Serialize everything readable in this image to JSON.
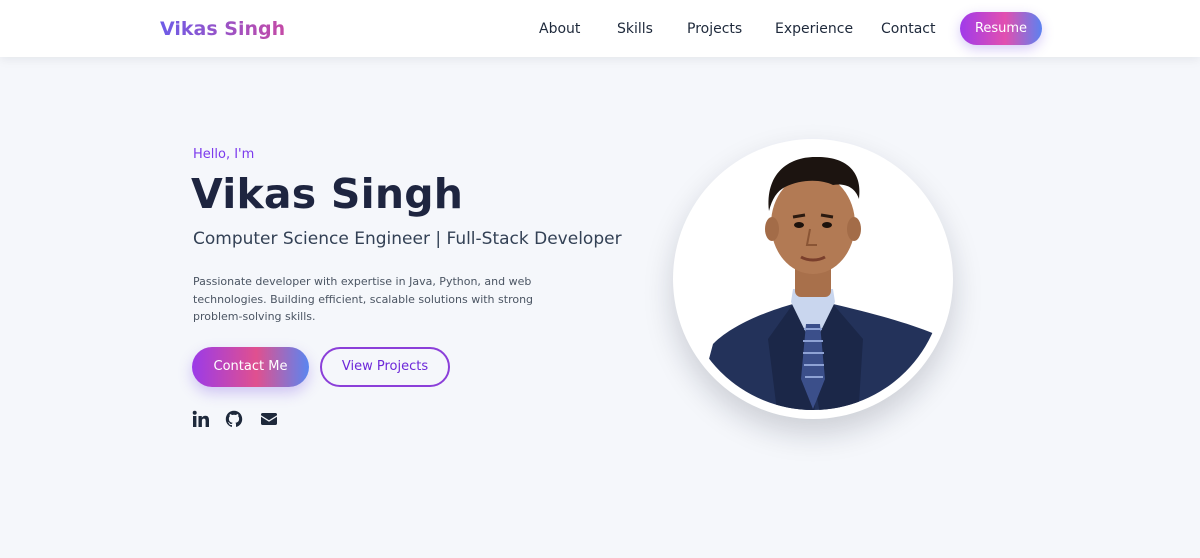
{
  "nav": {
    "logo": "Vikas Singh",
    "links": [
      "About",
      "Skills",
      "Projects",
      "Experience",
      "Contact"
    ],
    "resume_label": "Resume"
  },
  "hero": {
    "greeting": "Hello, I'm",
    "name": "Vikas Singh",
    "subtitle": "Computer Science Engineer | Full-Stack Developer",
    "description": "Passionate developer with expertise in Java, Python, and web technologies. Building efficient, scalable solutions with strong problem-solving skills.",
    "contact_button": "Contact Me",
    "projects_button": "View Projects"
  },
  "social": {
    "icons": [
      "linkedin-icon",
      "github-icon",
      "email-icon"
    ]
  },
  "profile": {
    "image": "profile-photo"
  },
  "colors": {
    "accent": "#7c3aed",
    "gradient": [
      "#a03bea",
      "#e24fb0",
      "#5b82f0"
    ],
    "heading": "#1e2540",
    "background": "#f5f7fb"
  }
}
